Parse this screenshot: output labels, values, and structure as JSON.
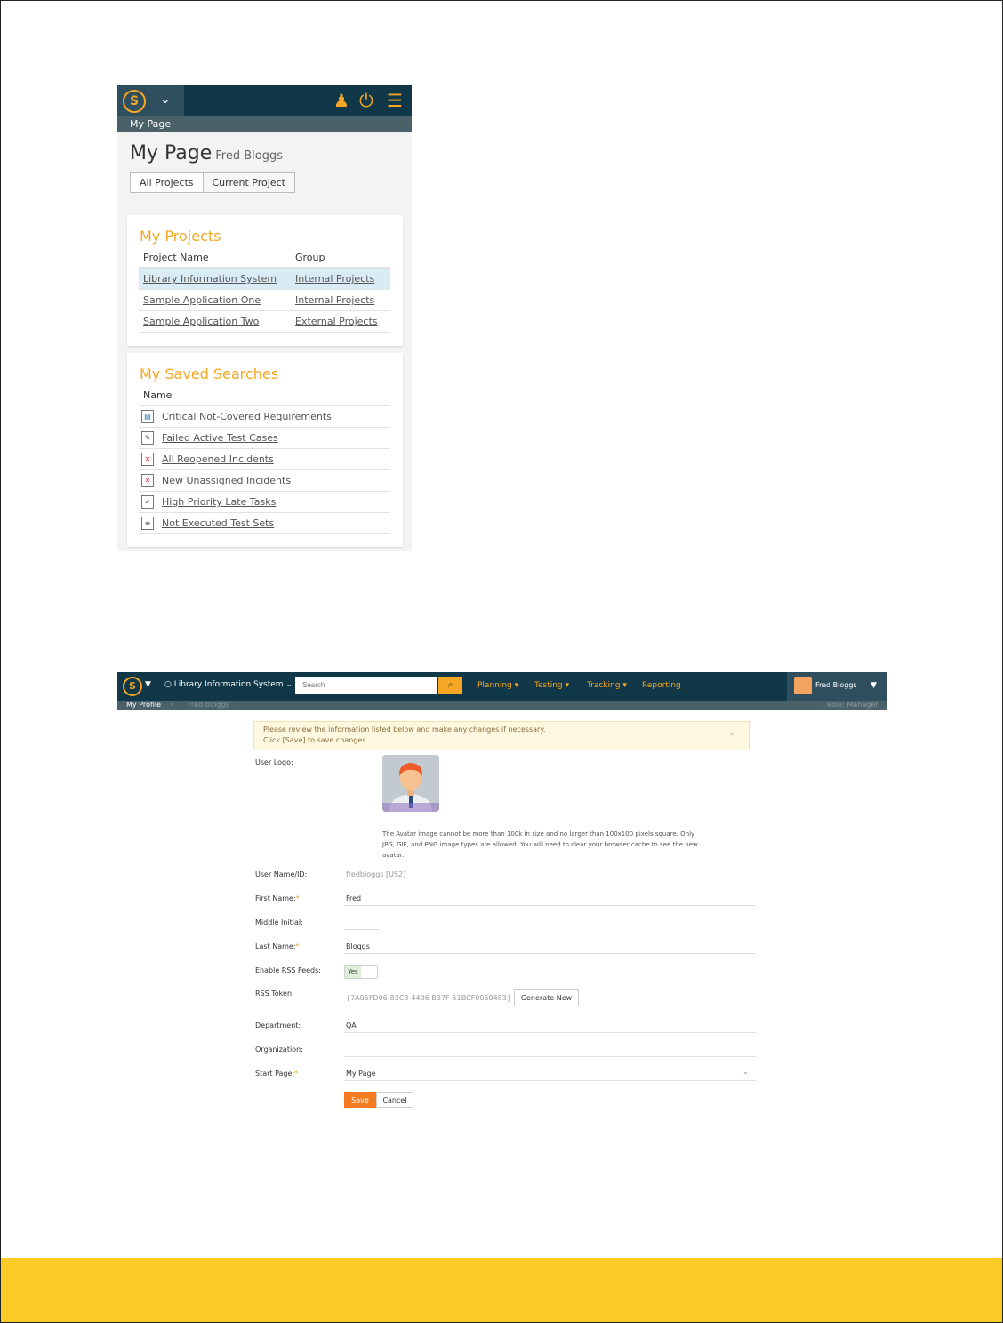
{
  "mobile": {
    "topbar": {
      "subtitle": "My Page"
    },
    "title": "My Page",
    "user": "Fred Bloggs",
    "tabs": [
      {
        "label": "All Projects"
      },
      {
        "label": "Current Project"
      }
    ],
    "projects": {
      "heading": "My Projects",
      "columns": [
        "Project Name",
        "Group"
      ],
      "rows": [
        {
          "name": "Library Information System",
          "group": "Internal Projects"
        },
        {
          "name": "Sample Application One",
          "group": "Internal Projects"
        },
        {
          "name": "Sample Application Two",
          "group": "External Projects"
        }
      ]
    },
    "searches": {
      "heading": "My Saved Searches",
      "column": "Name",
      "rows": [
        {
          "name": "Critical Not-Covered Requirements"
        },
        {
          "name": "Failed Active Test Cases"
        },
        {
          "name": "All Reopened Incidents"
        },
        {
          "name": "New Unassigned Incidents"
        },
        {
          "name": "High Priority Late Tasks"
        },
        {
          "name": "Not Executed Test Sets"
        }
      ]
    }
  },
  "desktop": {
    "project": "Library Information System",
    "search_placeholder": "Search",
    "menu": [
      "Planning",
      "Testing",
      "Tracking",
      "Reporting"
    ],
    "user": "Fred Bloggs",
    "breadcrumb": {
      "section": "My Profile",
      "current": "Fred Bloggs",
      "role": "Role: Manager"
    },
    "alert": {
      "line1": "Please review the information listed below and make any changes if necessary.",
      "line2": "Click [Save] to save changes.",
      "close": "×"
    },
    "form": {
      "logo_label": "User Logo:",
      "avatar_note": "The Avatar image cannot be more than 100k in size and no larger than 100x100 pixels square. Only JPG, GIF, and PNG image types are allowed. You will need to clear your browser cache to see the new avatar.",
      "username_label": "User Name/ID:",
      "username_value": "fredbloggs [US2]",
      "first_label": "First Name:",
      "first_value": "Fred",
      "middle_label": "Middle Initial:",
      "last_label": "Last Name:",
      "last_value": "Bloggs",
      "rss_label": "Enable RSS Feeds:",
      "rss_value": "Yes",
      "token_label": "RSS Token:",
      "token_value": "{7A05FD06-83C3-4436-B37F-51BCF0060483}",
      "generate_label": "Generate New",
      "dept_label": "Department:",
      "dept_value": "QA",
      "org_label": "Organization:",
      "start_label": "Start Page:",
      "start_value": "My Page",
      "save_label": "Save",
      "cancel_label": "Cancel"
    }
  },
  "colors": {
    "navy": "#103849",
    "accent": "#f5a623",
    "footer": "#fccb26",
    "save": "#f47b20"
  }
}
